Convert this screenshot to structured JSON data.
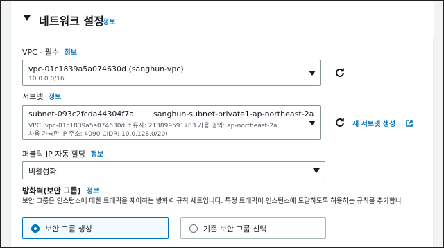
{
  "section": {
    "title": "네트워크 설정",
    "info": "정보"
  },
  "vpc": {
    "label": "VPC - 필수",
    "info": "정보",
    "selected_id": "vpc-01c1839a5a074630d (sanghun-vpc)",
    "cidr": "10.0.0.0/16"
  },
  "subnet": {
    "label": "서브넷",
    "info": "정보",
    "selected_id": "subnet-093c2fcda44304f7a",
    "selected_name": "sanghun-subnet-private1-ap-northeast-2a",
    "detail_line1": "VPC: vpc-01c1839a5a074630d    소유자: 213899591783    가용 영역: ap-northeast-2a",
    "detail_line2": "사용 가능한 IP 주소: 4090    CIDR: 10.0.128.0/20)",
    "create_link": "새 서브넷 생성"
  },
  "public_ip": {
    "label": "퍼블릭 IP 자동 할당",
    "info": "정보",
    "selected": "비활성화"
  },
  "firewall": {
    "label": "방화벽(보안 그룹)",
    "info": "정보",
    "description": "보안 그룹은 인스턴스에 대한 트래픽을 제어하는 방화벽 규칙 세트입니다. 특정 트래픽이 인스턴스에 도달하도록 허용하는 규칙을 추가합니",
    "option_create": "보안 그룹 생성",
    "option_existing": "기존 보안 그룹 선택",
    "selected_option": "create"
  },
  "colors": {
    "link": "#0073bb",
    "selected_border": "#0073bb",
    "selected_bg": "#f1faff"
  }
}
